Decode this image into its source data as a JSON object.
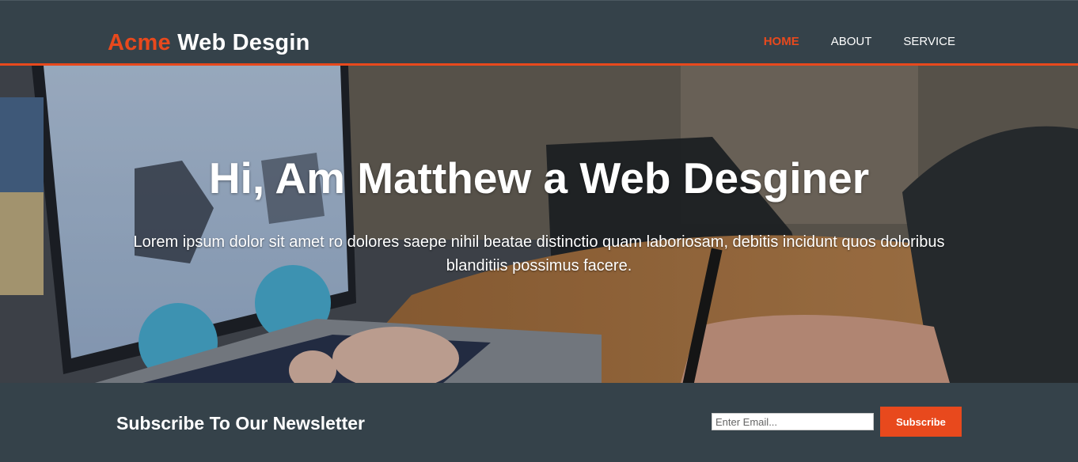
{
  "header": {
    "brand_highlight": "Acme",
    "brand_rest": "Web Desgin",
    "nav": [
      {
        "label": "HOME",
        "current": true
      },
      {
        "label": "ABOUT",
        "current": false
      },
      {
        "label": "SERVICE",
        "current": false
      }
    ]
  },
  "showcase": {
    "title": "Hi, Am Matthew a Web Desginer",
    "subtitle": "Lorem ipsum dolor sit amet ro dolores saepe nihil beatae distinctio quam laboriosam, debitis incidunt quos doloribus blanditiis possimus facere."
  },
  "newsletter": {
    "title": "Subscribe To Our Newsletter",
    "email_placeholder": "Enter Email...",
    "button_label": "Subscribe"
  },
  "colors": {
    "accent": "#e8491d",
    "dark": "#35424a"
  }
}
